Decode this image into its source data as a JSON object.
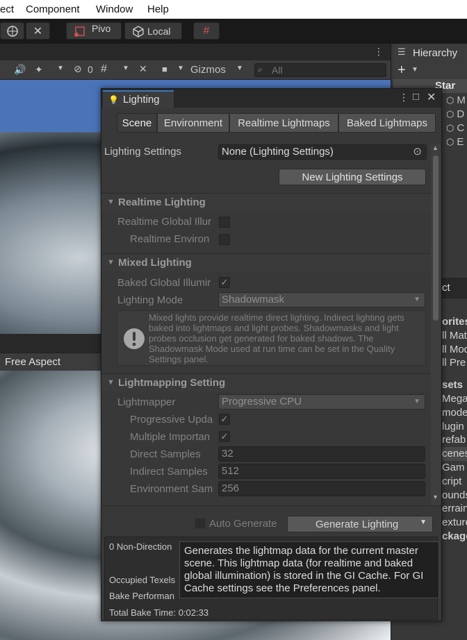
{
  "menu": [
    "ect",
    "Component",
    "Window",
    "Help"
  ],
  "toolbar": {
    "pivot_label": "Pivo",
    "local_label": "Local"
  },
  "scene_toolbar": {
    "visibility_count": "0",
    "gizmos_label": "Gizmos",
    "search_placeholder": "All"
  },
  "game": {
    "aspect_label": "Free Aspect"
  },
  "hierarchy": {
    "title": "Hierarchy",
    "scene_partial": "Star",
    "items": [
      "M",
      "D",
      "C",
      "E"
    ]
  },
  "project": {
    "tab_partial": "ct",
    "rows": [
      "orites",
      "ll Mat",
      "ll Mod",
      "ll Pre",
      "sets",
      "MegaP",
      "model",
      "lugin",
      "refab",
      "cenes",
      "Gam",
      "cript",
      "ounds",
      "errain",
      "exture",
      "ckage"
    ]
  },
  "lighting": {
    "title": "Lighting",
    "tabs": [
      "Scene",
      "Environment",
      "Realtime Lightmaps",
      "Baked Lightmaps"
    ],
    "settings_label": "Lighting Settings",
    "settings_value": "None (Lighting Settings)",
    "new_settings_button": "New Lighting Settings",
    "realtime_section": "Realtime Lighting",
    "realtime_gi_label": "Realtime Global Illur",
    "realtime_env_label": "Realtime Environ",
    "mixed_section": "Mixed Lighting",
    "baked_gi_label": "Baked Global Illumir",
    "lighting_mode_label": "Lighting Mode",
    "lighting_mode_value": "Shadowmask",
    "info_text": "Mixed lights provide realtime direct lighting. Indirect lighting gets baked into lightmaps and light probes. Shadowmasks and light probes occlusion get generated for baked shadows. The Shadowmask Mode used at run time can be set in the Quality Settings panel.",
    "lightmapping_section": "Lightmapping Setting",
    "lightmapper_label": "Lightmapper",
    "lightmapper_value": "Progressive CPU",
    "progressive_updates_label": "Progressive Upda",
    "multiple_importance_label": "Multiple Importan",
    "direct_samples_label": "Direct Samples",
    "direct_samples_value": "32",
    "indirect_samples_label": "Indirect Samples",
    "indirect_samples_value": "512",
    "environment_samples_label": "Environment Sam",
    "environment_samples_value": "256",
    "auto_generate_label": "Auto Generate",
    "generate_button": "Generate Lighting",
    "stats_line1": "0 Non-Direction",
    "stats_line2": "Occupied Texels",
    "stats_line3": "Bake Performan",
    "stats_total": "Total Bake Time: 0:02:33",
    "tooltip": "Generates the lightmap data for the current master scene.  This lightmap data (for realtime and baked global illumination) is stored in the GI Cache. For GI Cache settings see the Preferences panel."
  },
  "colors": {
    "accent": "#3a79bb",
    "panel": "#383838",
    "dark": "#191919"
  }
}
